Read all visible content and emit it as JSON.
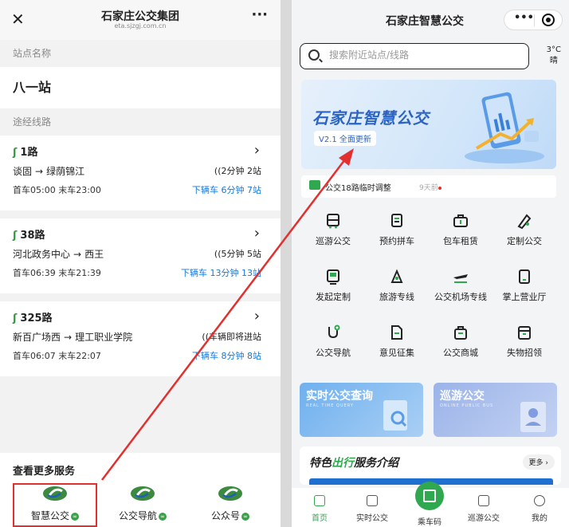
{
  "left": {
    "header": {
      "title": "石家庄公交集团",
      "domain": "eta.sjzgj.com.cn",
      "more": "···",
      "close": "✕"
    },
    "station_section": "站点名称",
    "station_name": "八一站",
    "routes_section": "途经线路",
    "routes": [
      {
        "name": "1路",
        "from": "谈固",
        "arrow": "→",
        "to": "绿荫锦江",
        "eta": "2分钟 2站",
        "times": "首车05:00 末车23:00",
        "next": "下辆车 6分钟 7站"
      },
      {
        "name": "38路",
        "from": "河北政务中心",
        "arrow": "→",
        "to": "西王",
        "eta": "5分钟 5站",
        "times": "首车06:39 末车21:39",
        "next": "下辆车 13分钟 13站"
      },
      {
        "name": "325路",
        "from": "新百广场西",
        "arrow": "→",
        "to": "理工职业学院",
        "eta": "车辆即将进站",
        "times": "首车06:07 末车22:07",
        "next": "下辆车 8分钟 8站"
      }
    ],
    "more_services_title": "查看更多服务",
    "services": [
      {
        "label": "智慧公交"
      },
      {
        "label": "公交导航"
      },
      {
        "label": "公众号"
      }
    ]
  },
  "right": {
    "header": {
      "title": "石家庄智慧公交",
      "dots": "•••"
    },
    "search": {
      "placeholder": "搜索附近站点/线路"
    },
    "weather": {
      "temp": "3°C",
      "cond": "晴"
    },
    "banner": {
      "title": "石家庄智慧公交",
      "version": "V2.1 全面更新"
    },
    "notice": {
      "text": "公交18路临时调整",
      "time": "9天前"
    },
    "grid": [
      {
        "label": "巡游公交",
        "icon": "bus-icon"
      },
      {
        "label": "预约拼车",
        "icon": "carpool-icon"
      },
      {
        "label": "包车租赁",
        "icon": "briefcase-icon"
      },
      {
        "label": "定制公交",
        "icon": "custom-route-icon"
      },
      {
        "label": "发起定制",
        "icon": "bus-front-icon"
      },
      {
        "label": "旅游专线",
        "icon": "travel-icon"
      },
      {
        "label": "公交机场专线",
        "icon": "airplane-icon"
      },
      {
        "label": "掌上营业厅",
        "icon": "tablet-icon"
      },
      {
        "label": "公交导航",
        "icon": "navigation-icon"
      },
      {
        "label": "意见征集",
        "icon": "document-icon"
      },
      {
        "label": "公交商城",
        "icon": "shop-icon"
      },
      {
        "label": "失物招领",
        "icon": "box-icon"
      }
    ],
    "cards": [
      {
        "title": "实时公交查询",
        "sub": "REAL TIME QUERY"
      },
      {
        "title": "巡游公交",
        "sub": "ONLINE PUBLIC BUS"
      }
    ],
    "features": {
      "title_prefix": "特色",
      "title_highlight": "出行",
      "title_suffix": "服务介绍",
      "more": "更多 ›"
    },
    "tabs": [
      {
        "label": "首页"
      },
      {
        "label": "实时公交"
      },
      {
        "label": "乘车码"
      },
      {
        "label": "巡游公交"
      },
      {
        "label": "我的"
      }
    ]
  },
  "colors": {
    "green": "#2fa84f",
    "blue": "#1677d9",
    "red": "#e23030"
  }
}
